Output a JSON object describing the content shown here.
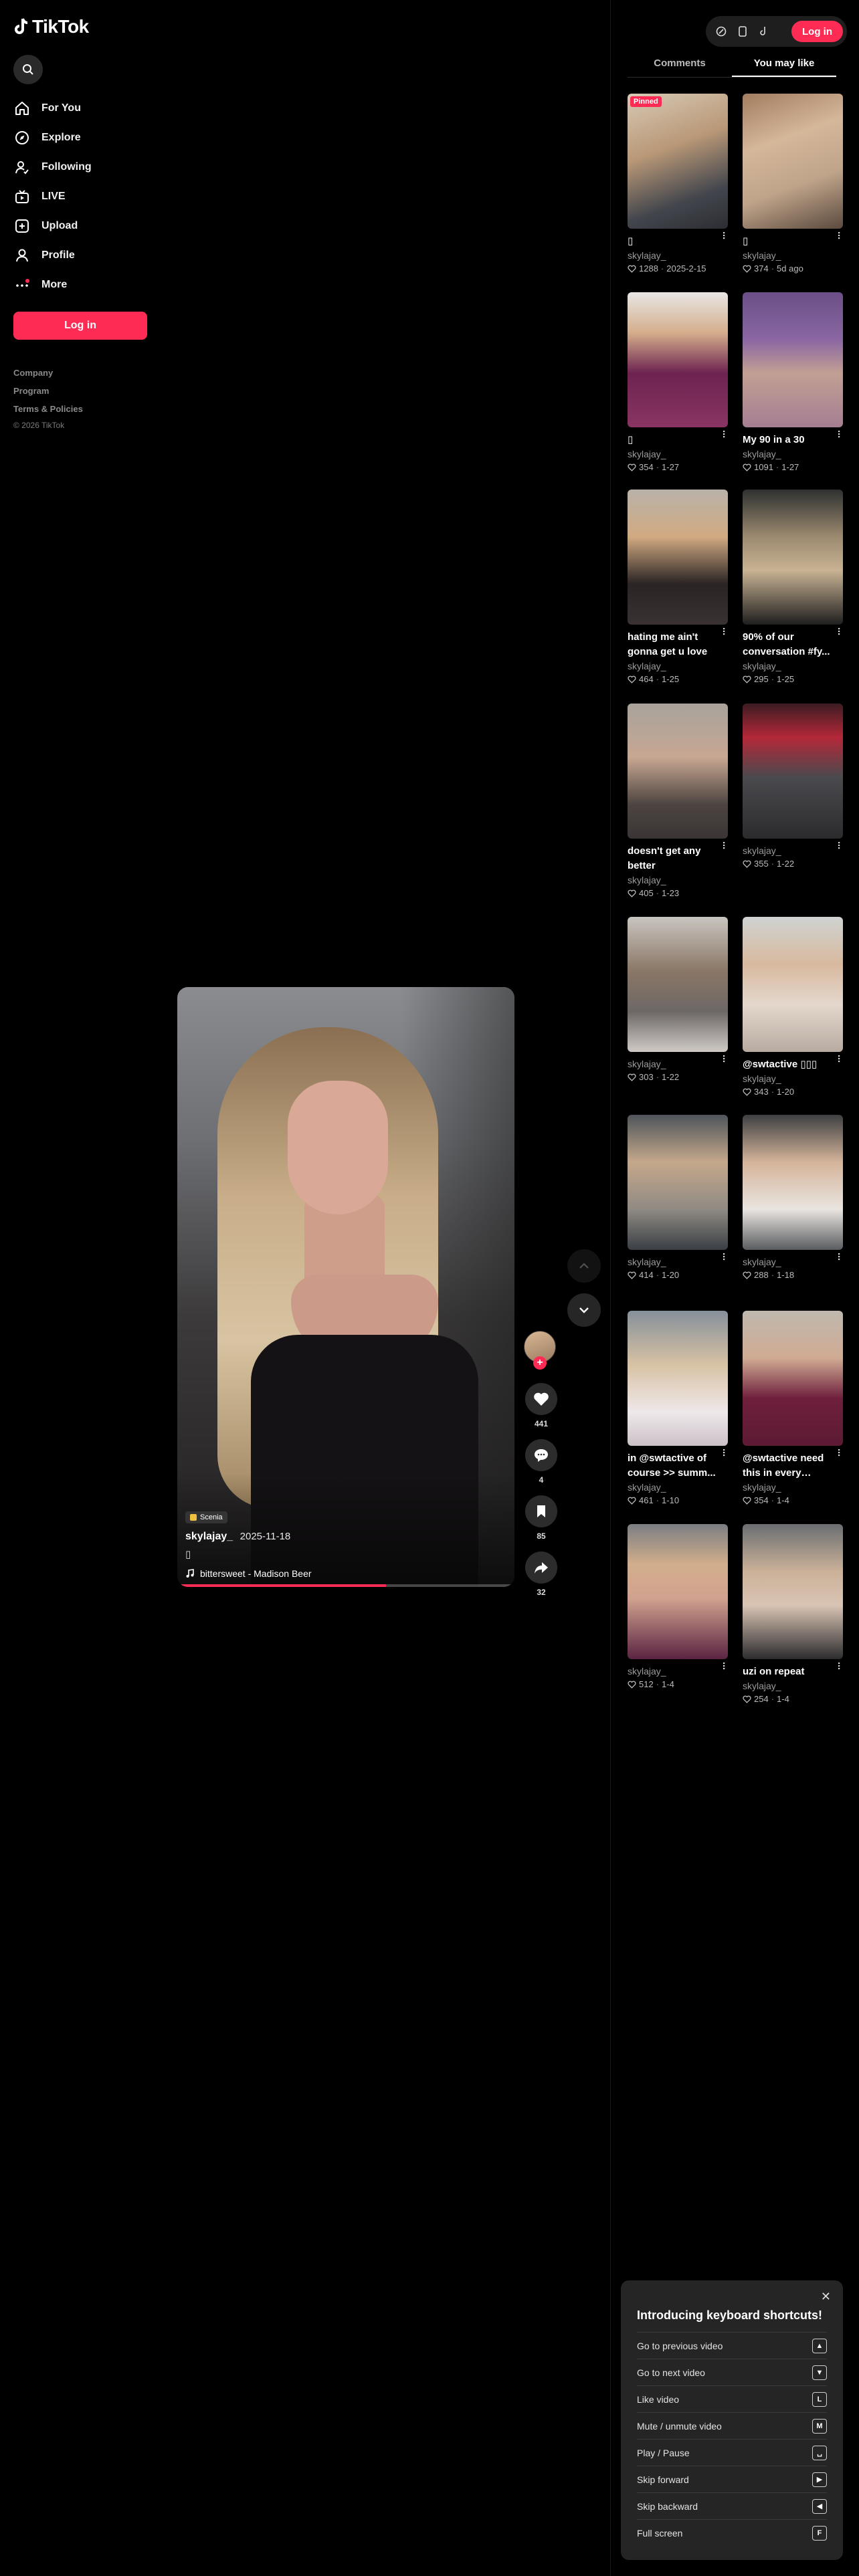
{
  "app": {
    "logo_text": "TikTok"
  },
  "sidebar": {
    "items": [
      {
        "label": "For You",
        "icon": "home-icon"
      },
      {
        "label": "Explore",
        "icon": "compass-icon"
      },
      {
        "label": "Following",
        "icon": "following-icon"
      },
      {
        "label": "LIVE",
        "icon": "live-icon"
      },
      {
        "label": "Upload",
        "icon": "upload-icon"
      },
      {
        "label": "Profile",
        "icon": "profile-icon"
      },
      {
        "label": "More",
        "icon": "more-icon"
      }
    ],
    "login_label": "Log in",
    "links": [
      "Company",
      "Program",
      "Terms & Policies"
    ],
    "copyright": "© 2026 TikTok"
  },
  "video": {
    "badge": "Scenia",
    "author": "skylajay_",
    "date": "2025-11-18",
    "caption": "▯",
    "music": "bittersweet - Madison Beer",
    "progress": 0.62
  },
  "actions": {
    "likes": "441",
    "comments": "4",
    "saves": "85",
    "shares": "32"
  },
  "topbar": {
    "login_label": "Log in"
  },
  "tabs": [
    {
      "label": "Comments",
      "active": false
    },
    {
      "label": "You may like",
      "active": true
    }
  ],
  "recommendations": [
    {
      "title": "▯",
      "author": "skylajay_",
      "likes": "1288",
      "date": "2025-2-15",
      "pinned": "Pinned"
    },
    {
      "title": "▯",
      "author": "skylajay_",
      "likes": "374",
      "date": "5d ago"
    },
    {
      "title": "▯",
      "author": "skylajay_",
      "likes": "354",
      "date": "1-27"
    },
    {
      "title": "My 90 in a 30",
      "author": "skylajay_",
      "likes": "1091",
      "date": "1-27"
    },
    {
      "title": "hating me ain't gonna get u love",
      "author": "skylajay_",
      "likes": "464",
      "date": "1-25"
    },
    {
      "title": "90% of our conversation #fy...",
      "author": "skylajay_",
      "likes": "295",
      "date": "1-25"
    },
    {
      "title": "doesn't get any better",
      "author": "skylajay_",
      "likes": "405",
      "date": "1-23"
    },
    {
      "title": "",
      "author": "skylajay_",
      "likes": "355",
      "date": "1-22"
    },
    {
      "title": "",
      "author": "skylajay_",
      "likes": "303",
      "date": "1-22"
    },
    {
      "title": "@swtactive ▯▯▯",
      "author": "skylajay_",
      "likes": "343",
      "date": "1-20"
    },
    {
      "title": "",
      "author": "skylajay_",
      "likes": "414",
      "date": "1-20"
    },
    {
      "title": "",
      "author": "skylajay_",
      "likes": "288",
      "date": "1-18"
    },
    {
      "title": "in @swtactive of course >> summ...",
      "author": "skylajay_",
      "likes": "461",
      "date": "1-10"
    },
    {
      "title": "@swtactive need this in every colour",
      "author": "skylajay_",
      "likes": "354",
      "date": "1-4"
    },
    {
      "title": "",
      "author": "skylajay_",
      "likes": "512",
      "date": "1-4"
    },
    {
      "title": "uzi on repeat",
      "author": "skylajay_",
      "likes": "254",
      "date": "1-4"
    }
  ],
  "shortcuts": {
    "title": "Introducing keyboard shortcuts!",
    "items": [
      {
        "label": "Go to previous video",
        "key": "▲"
      },
      {
        "label": "Go to next video",
        "key": "▼"
      },
      {
        "label": "Like video",
        "key": "L"
      },
      {
        "label": "Mute / unmute video",
        "key": "M"
      },
      {
        "label": "Play / Pause",
        "key": "␣"
      },
      {
        "label": "Skip forward",
        "key": "▶"
      },
      {
        "label": "Skip backward",
        "key": "◀"
      },
      {
        "label": "Full screen",
        "key": "F"
      }
    ]
  },
  "colors": {
    "accent": "#fe2c55",
    "background": "#000000"
  }
}
